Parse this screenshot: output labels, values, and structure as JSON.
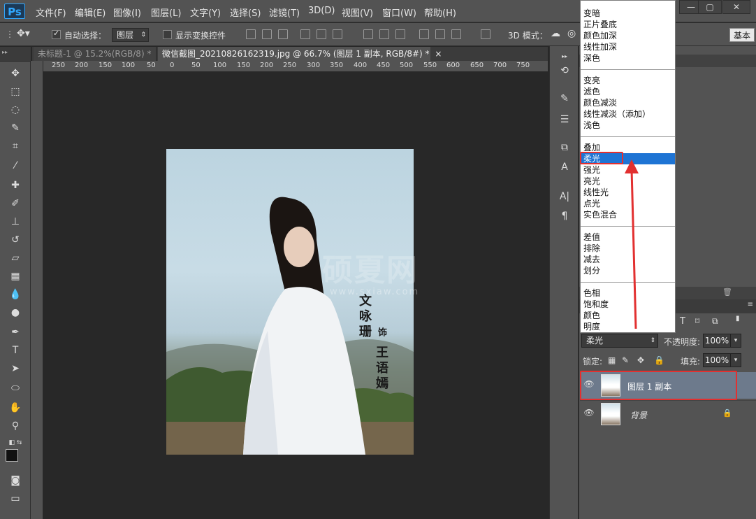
{
  "app": {
    "logo": "Ps"
  },
  "menu": [
    "文件(F)",
    "编辑(E)",
    "图像(I)",
    "图层(L)",
    "文字(Y)",
    "选择(S)",
    "滤镜(T)",
    "3D(D)",
    "视图(V)",
    "窗口(W)",
    "帮助(H)"
  ],
  "window_controls": {
    "minimize": "—",
    "restore": "▢",
    "close": "✕"
  },
  "options": {
    "auto_select_label": "自动选择：",
    "auto_select_value": "图层",
    "show_transform_label": "显示变换控件",
    "mode_3d_label": "3D 模式：",
    "workspace": "基本"
  },
  "tabs": [
    {
      "label": "未标题-1 @ 15.2%(RGB/8) *",
      "close": "×"
    },
    {
      "label": "微信截图_20210826162319.jpg @ 66.7% (图层 1 副本, RGB/8#) *",
      "close": "×"
    }
  ],
  "ruler_ticks": [
    "250",
    "200",
    "150",
    "100",
    "50",
    "0",
    "50",
    "100",
    "150",
    "200",
    "250",
    "300",
    "350",
    "400",
    "450",
    "500",
    "550",
    "600",
    "650",
    "700",
    "750"
  ],
  "photo": {
    "watermark": "硕夏网",
    "watermark_url": "www.sxiaw.com",
    "caption_name": "文咏珊",
    "caption_role": "饰",
    "caption_char": "王语嫣"
  },
  "blend_modes": {
    "group1": [
      "变暗",
      "正片叠底",
      "颜色加深",
      "线性加深",
      "深色"
    ],
    "group2": [
      "变亮",
      "滤色",
      "颜色减淡",
      "线性减淡（添加）",
      "浅色"
    ],
    "group3": [
      "叠加",
      "柔光",
      "强光",
      "亮光",
      "线性光",
      "点光",
      "实色混合"
    ],
    "group4": [
      "差值",
      "排除",
      "减去",
      "划分"
    ],
    "group5": [
      "色相",
      "饱和度",
      "颜色",
      "明度"
    ],
    "selected": "柔光"
  },
  "layers_panel": {
    "blend_value": "柔光",
    "opacity_label": "不透明度:",
    "opacity_value": "100%",
    "lock_label": "锁定:",
    "fill_label": "填充:",
    "fill_value": "100%",
    "layers": [
      {
        "name": "图层 1 副本",
        "selected": true
      },
      {
        "name": "背景",
        "selected": false
      }
    ]
  },
  "colors": {
    "accent": "#e23030",
    "selection": "#1e74d4",
    "ui_bg": "#535353"
  }
}
